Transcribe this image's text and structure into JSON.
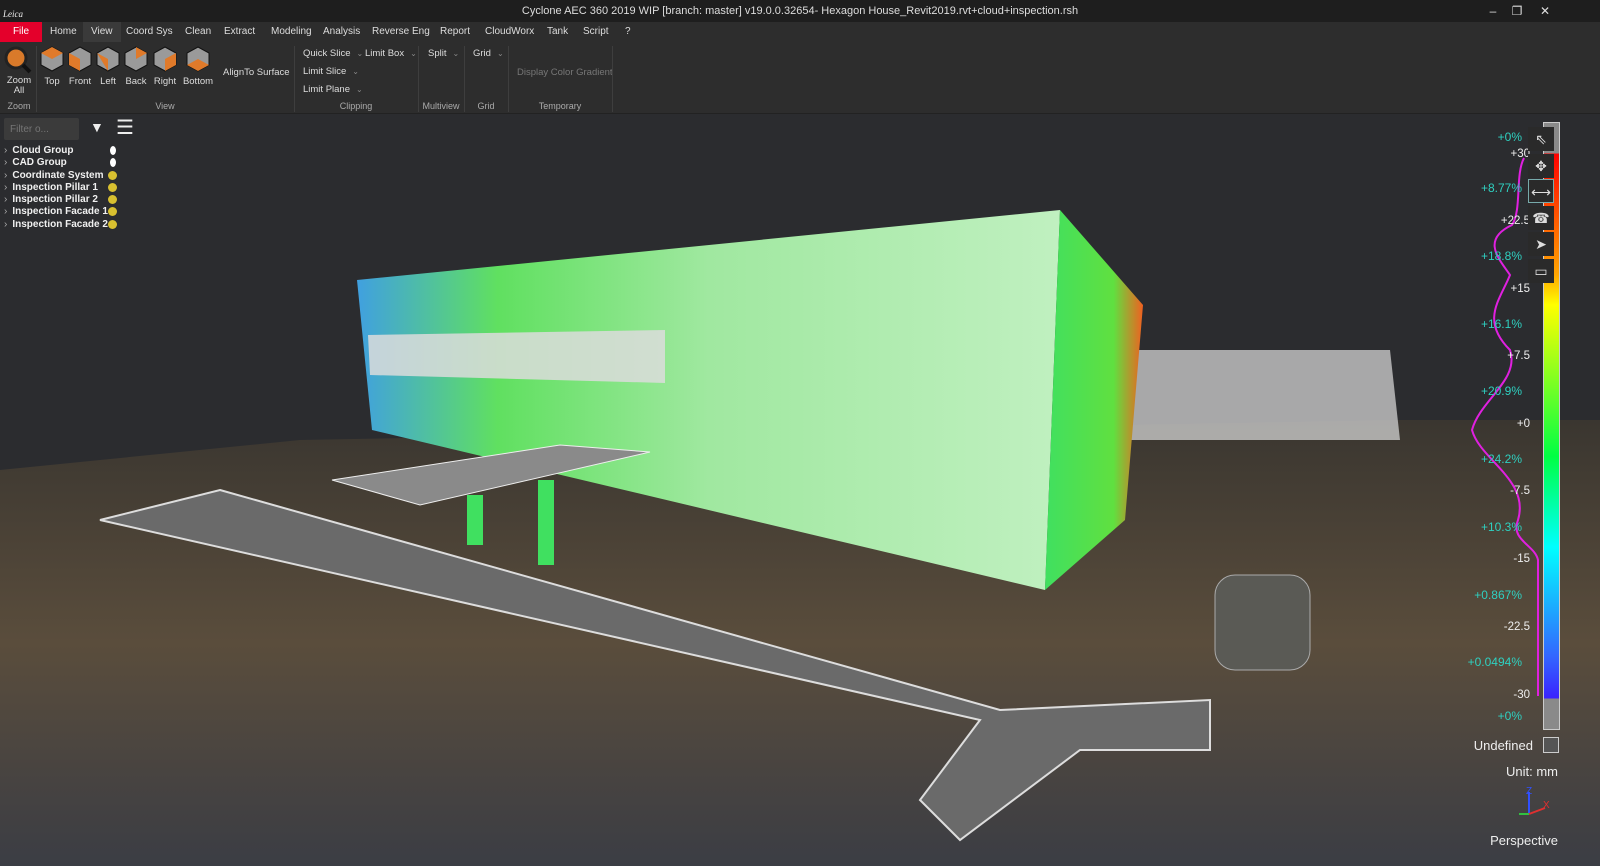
{
  "window": {
    "title": "Cyclone AEC 360 2019 WIP [branch: master] v19.0.0.32654- Hexagon House_Revit2019.rvt+cloud+inspection.rsh",
    "logo": "Leica",
    "minimize": "–",
    "restore": "❐",
    "close": "✕"
  },
  "menu": [
    "File",
    "Home",
    "View",
    "Coord Sys",
    "Clean",
    "Extract",
    "Modeling",
    "Analysis",
    "Reverse Eng",
    "Report",
    "CloudWorx",
    "Tank",
    "Script",
    "?"
  ],
  "menu_active": "View",
  "ribbon": {
    "zoom_all": "Zoom All",
    "zoom_group": "Zoom",
    "views": [
      "Top",
      "Front",
      "Left",
      "Back",
      "Right",
      "Bottom"
    ],
    "align": "AlignTo Surface",
    "view_group": "View",
    "quick_slice": "Quick Slice",
    "limit_box": "Limit Box",
    "limit_slice": "Limit Slice",
    "limit_plane": "Limit Plane",
    "clipping_group": "Clipping",
    "split": "Split",
    "multiview_group": "Multiview",
    "grid": "Grid",
    "grid_group": "Grid",
    "display_gradient": "Display Color Gradient",
    "temporary_group": "Temporary"
  },
  "sidebar": {
    "filter_placeholder": "Filter o...",
    "items": [
      {
        "label": "Cloud Group",
        "icon": "bulb-white"
      },
      {
        "label": "CAD Group",
        "icon": "bulb-white"
      },
      {
        "label": "Coordinate System",
        "icon": "bulb-yellow"
      },
      {
        "label": "Inspection Pillar 1",
        "icon": "bulb-yellow"
      },
      {
        "label": "Inspection Pillar 2",
        "icon": "bulb-yellow"
      },
      {
        "label": "Inspection Facade 1",
        "icon": "bulb-yellow"
      },
      {
        "label": "Inspection Facade 2",
        "icon": "bulb-yellow"
      }
    ]
  },
  "legend": {
    "ticks": [
      "+30",
      "+22.5",
      "+15",
      "+7.5",
      "+0",
      "-7.5",
      "-15",
      "-22.5",
      "-30"
    ],
    "percentages": [
      "+0%",
      "+8.77%",
      "+18.8%",
      "+16.1%",
      "+20.9%",
      "+24.2%",
      "+10.3%",
      "+0.867%",
      "+0.0494%",
      "+0%"
    ],
    "undefined_label": "Undefined",
    "unit": "Unit: mm",
    "projection": "Perspective",
    "colors": {
      "top": "#ff0000",
      "upper": "#ffa500",
      "mid_upper": "#ffff00",
      "mid": "#00ff44",
      "mid_lower": "#00ffff",
      "lower": "#3366ff",
      "bottom": "#3a22ff",
      "out_of_range": "#8a8a8a",
      "histogram": "#e020e0"
    }
  },
  "tools": [
    "select-icon",
    "orbit-icon",
    "pan-icon",
    "walk-icon",
    "fly-icon",
    "clip-box-icon"
  ],
  "axes": {
    "x": "X",
    "y": "Y",
    "z": "Z"
  }
}
